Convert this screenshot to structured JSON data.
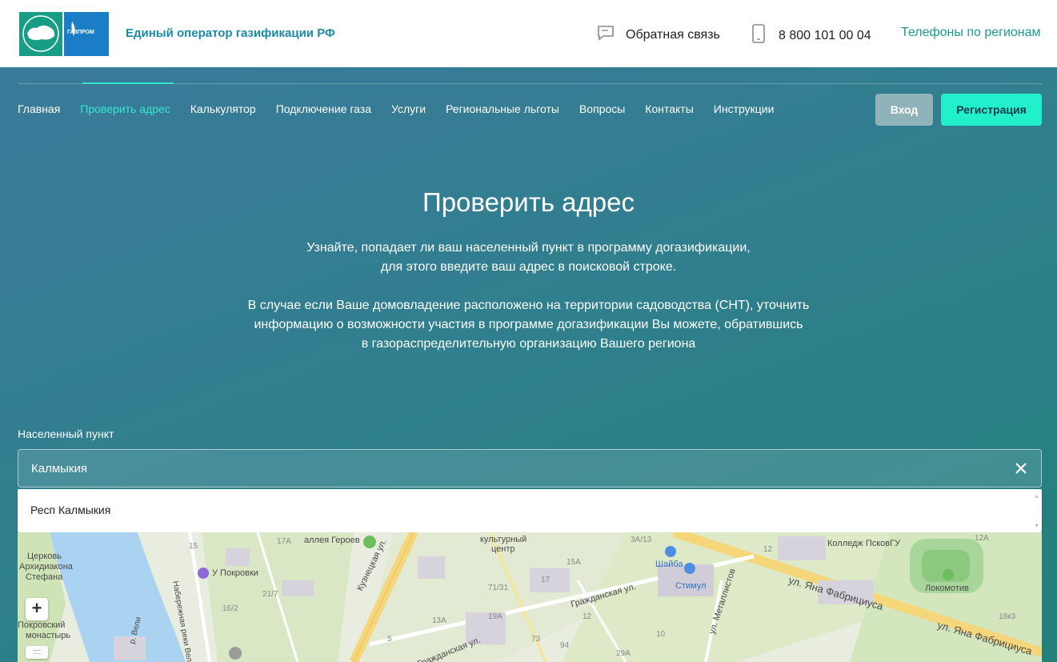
{
  "header": {
    "brand": "Единый оператор газификации РФ",
    "logo_text": "ГАЗПРОМ",
    "feedback_label": "Обратная связь",
    "phone": "8 800 101 00 04",
    "regions_link": "Телефоны по регионам"
  },
  "nav": {
    "items": [
      "Главная",
      "Проверить адрес",
      "Калькулятор",
      "Подключение газа",
      "Услуги",
      "Региональные льготы",
      "Вопросы",
      "Контакты",
      "Инструкции"
    ],
    "active": "Проверить адрес",
    "login_label": "Вход",
    "register_label": "Регистрация"
  },
  "hero": {
    "title": "Проверить адрес",
    "desc1_line1": "Узнайте, попадает ли ваш населенный пункт в программу догазификации,",
    "desc1_line2": "для этого введите ваш адрес в поисковой строке.",
    "desc2_line1": "В случае если Ваше домовладение расположено на территории садоводства (СНТ), уточнить",
    "desc2_line2": "информацию о возможности участия в программе догазификации Вы можете, обратившись",
    "desc2_line3": "в газораспределительную организацию Вашего региона"
  },
  "search": {
    "label": "Населенный пункт",
    "value": "Калмыкия",
    "clear_icon": "close-icon"
  },
  "suggestions": [
    "Респ Калмыкия"
  ],
  "map": {
    "labels": [
      "Церковь",
      "Архидиакона",
      "Стефана",
      "У Покровки",
      "аллея Героев",
      "Кузнецкая ул.",
      "культурный",
      "центр",
      "Гражданская ул.",
      "Шайба",
      "Стимул",
      "ул. Металлистов",
      "Колледж ПсковГУ",
      "Локомотив",
      "ул. Яна Фабрициуса",
      "ул. Яна Фабрициуса",
      "Набережная реки Великой",
      "Покровский",
      "монастырь",
      "р. Вели",
      "Гражданская ул.",
      "15",
      "17A",
      "15A",
      "17",
      "71/31",
      "3A/13",
      "12",
      "12A",
      "21/7",
      "16/2",
      "13A",
      "19A",
      "12",
      "5",
      "73",
      "94",
      "29A",
      "18к3",
      "10"
    ],
    "zoom_label": "+",
    "more_label": "::::"
  },
  "colors": {
    "accent": "#22f0cd",
    "nav_active": "#39e6d0",
    "brand_text": "#1b8aa8",
    "regions_link": "#1d9a8e",
    "hero_start": "#3a7a9a",
    "hero_end": "#23807a"
  }
}
